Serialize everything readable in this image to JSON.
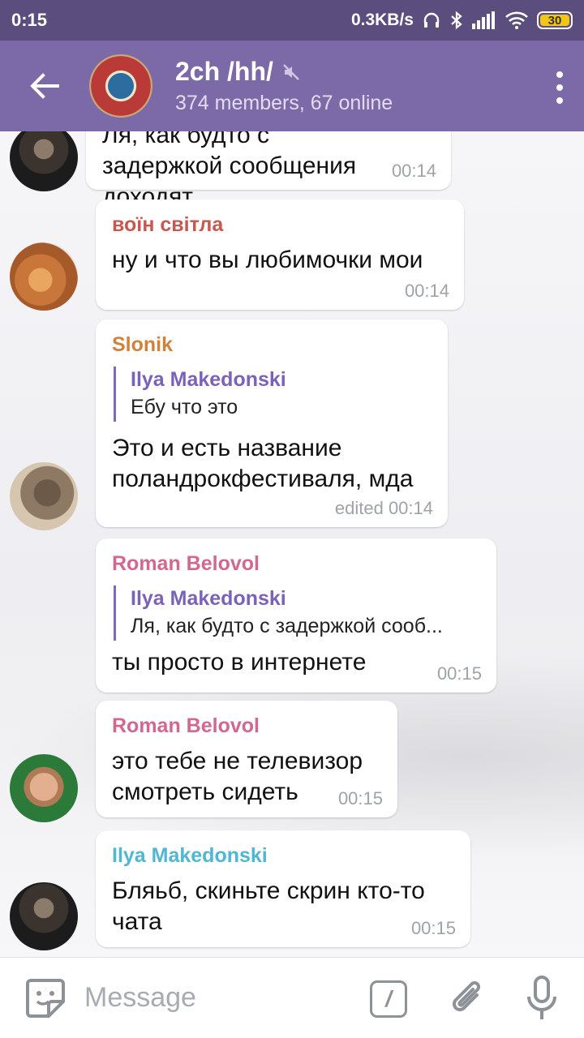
{
  "status_bar": {
    "time": "0:15",
    "net_speed": "0.3KB/s",
    "battery": "30"
  },
  "header": {
    "back_icon": "arrow-left-icon",
    "title": "2ch /hh/",
    "muted_icon": "muted-speaker-icon",
    "subtitle": "374 members, 67 online",
    "menu_icon": "more-vertical-icon"
  },
  "messages": [
    {
      "sender": "",
      "sender_color": "",
      "text": "Ля, как будто с задержкой сообщения доходят",
      "time": "00:14"
    },
    {
      "sender": "воїн світла",
      "sender_color": "#c8584f",
      "text": "ну и что вы любимочки мои",
      "time": "00:14"
    },
    {
      "sender": "Slonik",
      "sender_color": "#d2823a",
      "reply": {
        "name": "Ilya Makedonski",
        "text": "Ебу что это"
      },
      "text": "Это и есть название поландрокфестиваля, мда",
      "time": "edited 00:14"
    },
    {
      "sender": "Roman Belovol",
      "sender_color": "#d2678f",
      "reply": {
        "name": "Ilya Makedonski",
        "text": "Ля, как будто с задержкой сооб..."
      },
      "text": "ты просто в интернете",
      "time": "00:15"
    },
    {
      "sender": "Roman Belovol",
      "sender_color": "#d2678f",
      "text": "это тебе не телевизор смотреть сидеть",
      "time": "00:15"
    },
    {
      "sender": "Ilya Makedonski",
      "sender_color": "#4fb6d4",
      "text": "Бляьб, скиньте скрин кто-то чата",
      "time": "00:15"
    }
  ],
  "input": {
    "placeholder": "Message",
    "command_symbol": "/"
  },
  "icons": [
    "sticker-icon",
    "command-icon",
    "paperclip-icon",
    "mic-icon"
  ],
  "colors": {
    "app_bar": "#7c6aa8",
    "status_bar": "#5b4e7e",
    "reply_accent": "#7f67bd"
  }
}
